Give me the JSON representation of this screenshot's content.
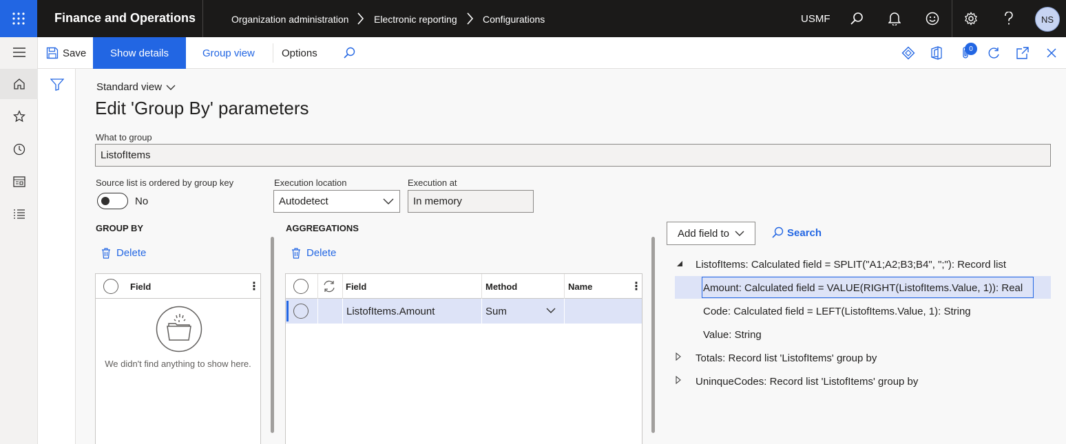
{
  "topbar": {
    "app_title": "Finance and Operations",
    "breadcrumbs": [
      "Organization administration",
      "Electronic reporting",
      "Configurations"
    ],
    "company": "USMF",
    "avatar_initials": "NS"
  },
  "actions": {
    "save": "Save",
    "show_details": "Show details",
    "group_view": "Group view",
    "options": "Options",
    "attachments_count": "0"
  },
  "page": {
    "view_selector": "Standard view",
    "title": "Edit 'Group By' parameters"
  },
  "form": {
    "what_to_group": {
      "label": "What to group",
      "value": "ListofItems"
    },
    "source_ordered": {
      "label": "Source list is ordered by group key",
      "value": "No"
    },
    "execution_location": {
      "label": "Execution location",
      "value": "Autodetect"
    },
    "execution_at": {
      "label": "Execution at",
      "value": "In memory"
    }
  },
  "group_by": {
    "heading": "GROUP BY",
    "delete": "Delete",
    "columns": [
      "Field"
    ],
    "empty_message": "We didn't find anything to show here."
  },
  "aggregations": {
    "heading": "AGGREGATIONS",
    "delete": "Delete",
    "columns": [
      "Field",
      "Method",
      "Name"
    ],
    "rows": [
      {
        "field": "ListofItems.Amount",
        "method": "Sum",
        "name": ""
      }
    ]
  },
  "datasource": {
    "add_field_to": "Add field to",
    "search": "Search",
    "tree": [
      "ListofItems: Calculated field = SPLIT(\"A1;A2;B3;B4\", \";\"): Record list",
      "Amount: Calculated field = VALUE(RIGHT(ListofItems.Value, 1)): Real",
      "Code: Calculated field = LEFT(ListofItems.Value, 1): String",
      "Value: String",
      "Totals: Record list 'ListofItems' group by",
      "UninqueCodes: Record list 'ListofItems' group by"
    ]
  },
  "colors": {
    "accent": "#2266e3",
    "topbar": "#1b1a19",
    "selection": "#dde3f7"
  }
}
